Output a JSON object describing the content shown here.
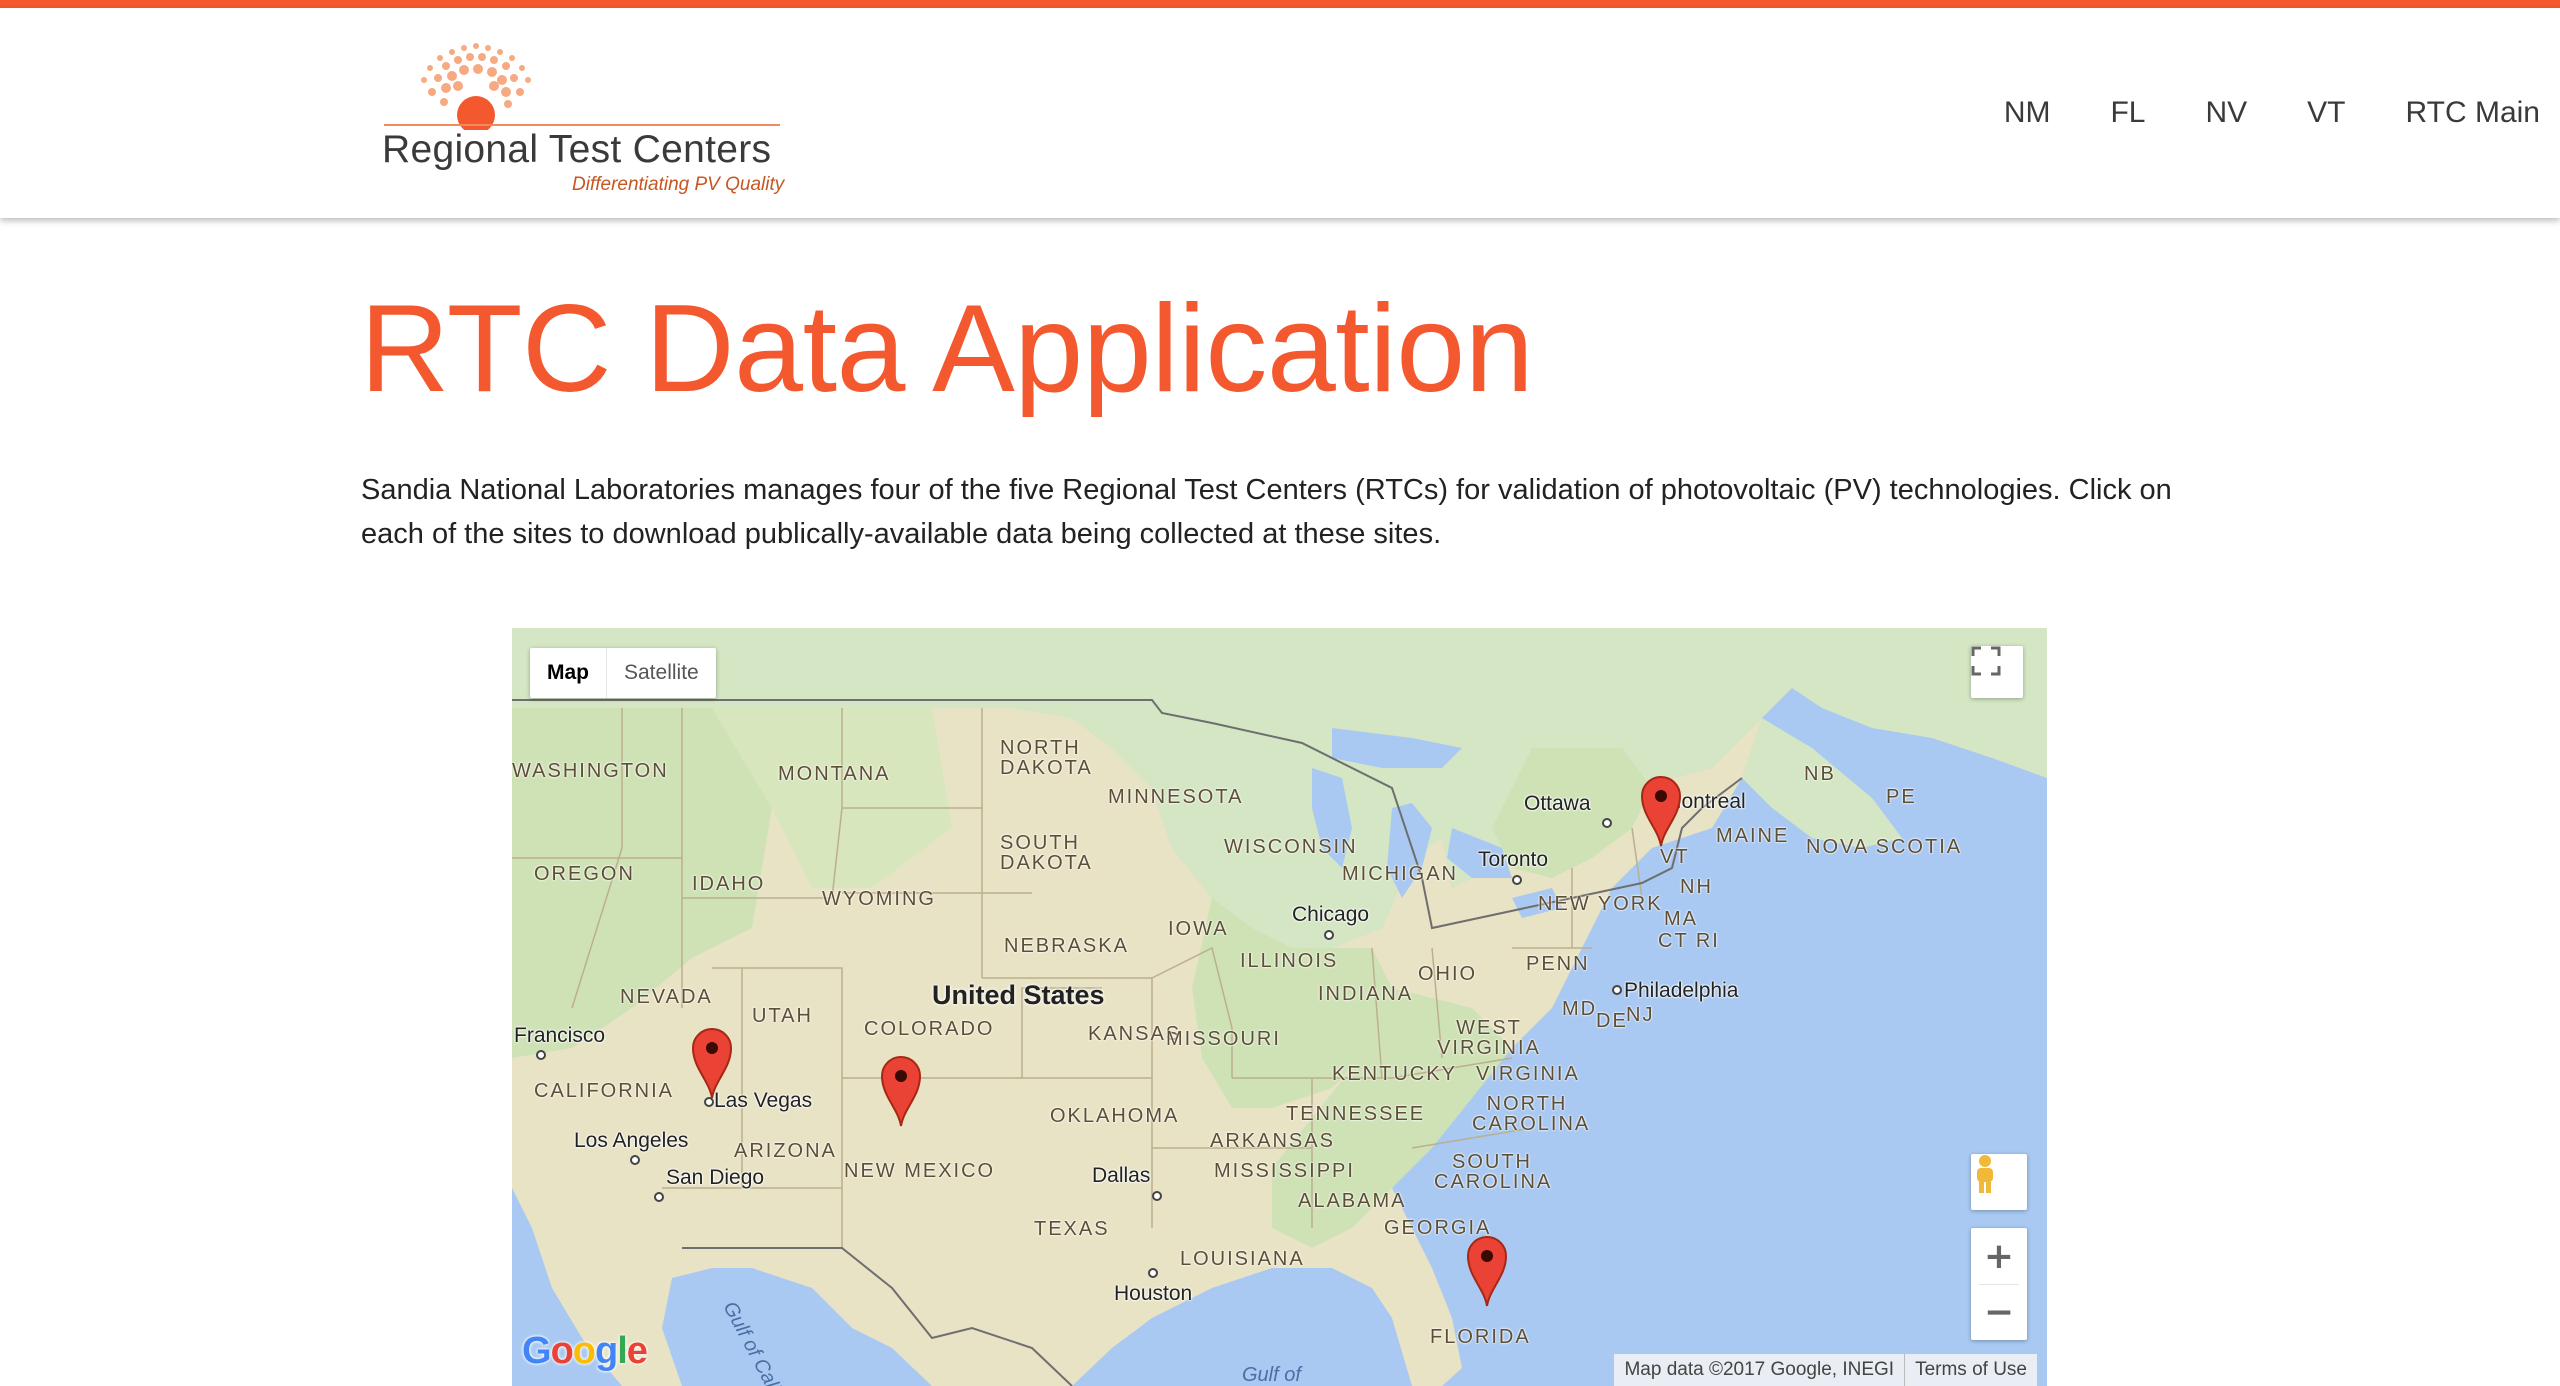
{
  "header": {
    "logo": {
      "title": "Regional Test Centers",
      "tagline": "Differentiating PV Quality"
    },
    "nav": [
      "NM",
      "FL",
      "NV",
      "VT",
      "RTC Main"
    ]
  },
  "page": {
    "title": "RTC Data Application",
    "intro": "Sandia National Laboratories manages four of the five Regional Test Centers (RTCs) for validation of photovoltaic (PV) technologies. Click on each of the sites to download publically-available data being collected at these sites."
  },
  "map": {
    "type_buttons": {
      "map": "Map",
      "satellite": "Satellite"
    },
    "zoom_in": "+",
    "zoom_out": "−",
    "google_logo": "Google",
    "attribution": "Map data ©2017 Google, INEGI",
    "terms": "Terms of Use",
    "country_label": "United States",
    "state_labels": [
      "WASHINGTON",
      "MONTANA",
      "NORTH DAKOTA",
      "MINNESOTA",
      "OREGON",
      "IDAHO",
      "WYOMING",
      "SOUTH DAKOTA",
      "WISCONSIN",
      "MICHIGAN",
      "NEVADA",
      "UTAH",
      "COLORADO",
      "NEBRASKA",
      "IOWA",
      "ILLINOIS",
      "INDIANA",
      "OHIO",
      "KANSAS",
      "MISSOURI",
      "CALIFORNIA",
      "ARIZONA",
      "NEW MEXICO",
      "OKLAHOMA",
      "ARKANSAS",
      "TENNESSEE",
      "KENTUCKY",
      "WEST VIRGINIA",
      "VIRGINIA",
      "NORTH CAROLINA",
      "SOUTH CAROLINA",
      "MISSISSIPPI",
      "ALABAMA",
      "GEORGIA",
      "TEXAS",
      "LOUISIANA",
      "FLORIDA",
      "NEW YORK",
      "PENN",
      "MAINE",
      "NH",
      "VT",
      "MA",
      "CT RI",
      "NJ",
      "MD",
      "DE",
      "NB",
      "PE",
      "NOVA SCOTIA"
    ],
    "city_labels": [
      "Ottawa",
      "Montreal",
      "Toronto",
      "Chicago",
      "Philadelphia",
      "Francisco",
      "Las Vegas",
      "Los Angeles",
      "San Diego",
      "Dallas",
      "Houston"
    ],
    "water_labels": [
      "Gulf of California",
      "Gulf of"
    ],
    "markers": [
      "NV site",
      "NM site",
      "VT site",
      "FL site"
    ],
    "colors": {
      "land": "#e8e3c5",
      "water": "#a9c9f2",
      "canada": "#d4e6c3",
      "marker": "#ea4335"
    }
  },
  "colors": {
    "accent": "#f4582e"
  }
}
